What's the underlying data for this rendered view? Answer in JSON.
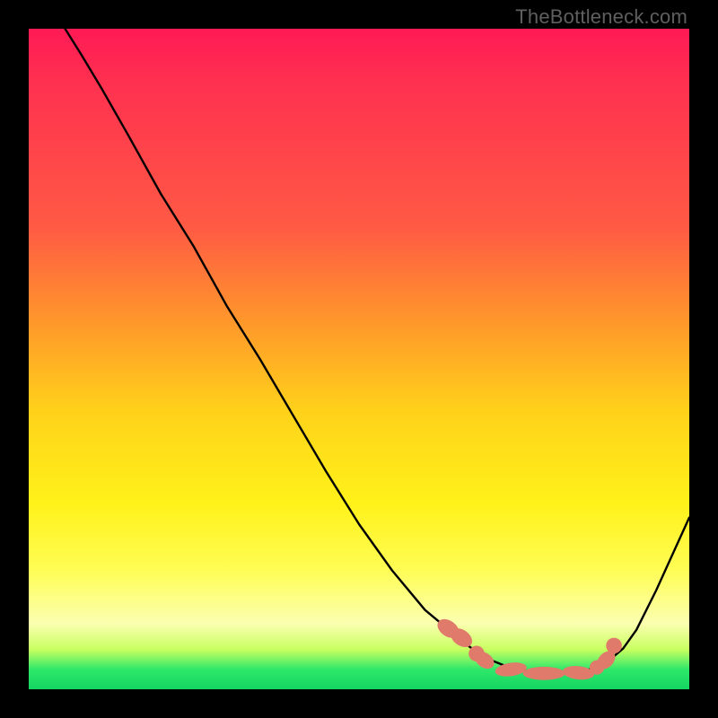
{
  "watermark": "TheBottleneck.com",
  "colors": {
    "curve": "#000000",
    "markers": "#e07a6b",
    "gradient_top": "#ff1a55",
    "gradient_bottom": "#14d462"
  },
  "chart_data": {
    "type": "line",
    "title": "",
    "xlabel": "",
    "ylabel": "",
    "xlim": [
      0,
      100
    ],
    "ylim": [
      0,
      100
    ],
    "note": "x and y values are in plot-area percent units; y=0 is top, y=100 is bottom",
    "series": [
      {
        "name": "curve",
        "x": [
          5.5,
          8,
          11,
          15,
          20,
          25,
          30,
          35,
          40,
          45,
          50,
          55,
          60,
          63,
          66,
          68,
          70,
          72,
          74,
          76,
          78,
          80,
          82,
          84,
          86,
          88,
          90,
          92,
          95,
          100
        ],
        "y": [
          0,
          4,
          9,
          16,
          25,
          33,
          42,
          50,
          58.5,
          67,
          75,
          82,
          88,
          90.5,
          93,
          94.5,
          95.6,
          96.4,
          97,
          97.4,
          97.6,
          97.7,
          97.6,
          97.3,
          96.6,
          95.5,
          93.8,
          91,
          85,
          74
        ]
      }
    ],
    "markers": [
      {
        "shape": "ellipse",
        "cx": 63.5,
        "cy": 90.8,
        "rx": 1.2,
        "ry": 1.8,
        "rot": -55
      },
      {
        "shape": "ellipse",
        "cx": 65.5,
        "cy": 92.2,
        "rx": 1.2,
        "ry": 1.8,
        "rot": -55
      },
      {
        "shape": "circle",
        "cx": 67.8,
        "cy": 94.6,
        "r": 1.2
      },
      {
        "shape": "ellipse",
        "cx": 69.0,
        "cy": 95.6,
        "rx": 1.1,
        "ry": 1.6,
        "rot": -55
      },
      {
        "shape": "ellipse",
        "cx": 73.0,
        "cy": 97.0,
        "rx": 2.4,
        "ry": 1.0,
        "rot": -8
      },
      {
        "shape": "ellipse",
        "cx": 78.0,
        "cy": 97.6,
        "rx": 3.2,
        "ry": 1.0,
        "rot": 0
      },
      {
        "shape": "ellipse",
        "cx": 83.2,
        "cy": 97.5,
        "rx": 2.4,
        "ry": 1.0,
        "rot": 6
      },
      {
        "shape": "circle",
        "cx": 86.0,
        "cy": 96.7,
        "r": 1.1
      },
      {
        "shape": "ellipse",
        "cx": 87.4,
        "cy": 95.6,
        "rx": 1.1,
        "ry": 1.6,
        "rot": 45
      },
      {
        "shape": "circle",
        "cx": 88.6,
        "cy": 93.4,
        "r": 1.2
      }
    ]
  }
}
